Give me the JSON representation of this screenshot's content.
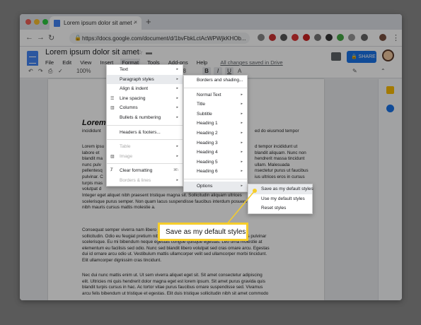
{
  "browser": {
    "tab_title": "Lorem ipsum dolor sit amet - ",
    "tab_close": "×",
    "new_tab": "+",
    "url": "https://docs.google.com/document/d/1bvFbkLctAcWPWjkKHOb..."
  },
  "doc": {
    "title": "Lorem ipsum dolor sit amet",
    "saved_status": "All changes saved in Drive",
    "share_label": "SHARE",
    "menus": [
      "File",
      "Edit",
      "View",
      "Insert",
      "Format",
      "Tools",
      "Add-ons",
      "Help"
    ]
  },
  "toolbar": {
    "zoom": "100%",
    "font_size": "18",
    "bold": "B",
    "italic": "I",
    "underline": "U",
    "text_color": "A"
  },
  "format_menu": {
    "items": [
      {
        "label": "Text",
        "arrow": "▸"
      },
      {
        "label": "Paragraph styles",
        "arrow": "▸"
      },
      {
        "label": "Align & indent",
        "arrow": "▸"
      },
      {
        "label": "Line spacing",
        "arrow": "▸"
      },
      {
        "label": "Columns",
        "arrow": "▸"
      },
      {
        "label": "Bullets & numbering",
        "arrow": "▸"
      },
      {
        "label": "Headers & footers..."
      },
      {
        "label": "Table",
        "arrow": "▸"
      },
      {
        "label": "Image",
        "arrow": "▸"
      },
      {
        "label": "Clear formatting",
        "shortcut": "⌘\\"
      },
      {
        "label": "Borders & lines",
        "arrow": "▸"
      }
    ]
  },
  "paragraph_menu": {
    "items": [
      {
        "label": "Borders and shading..."
      },
      {
        "label": "Normal Text",
        "arrow": "▸"
      },
      {
        "label": "Title",
        "arrow": "▸"
      },
      {
        "label": "Subtitle",
        "arrow": "▸"
      },
      {
        "label": "Heading 1",
        "arrow": "▸"
      },
      {
        "label": "Heading 2",
        "arrow": "▸"
      },
      {
        "label": "Heading 3",
        "arrow": "▸"
      },
      {
        "label": "Heading 4",
        "arrow": "▸"
      },
      {
        "label": "Heading 5",
        "arrow": "▸"
      },
      {
        "label": "Heading 6",
        "arrow": "▸"
      },
      {
        "label": "Options",
        "arrow": "▸"
      }
    ]
  },
  "options_menu": {
    "items": [
      {
        "label": "Save as my default styles"
      },
      {
        "label": "Use my default styles"
      },
      {
        "label": "Reset styles"
      }
    ]
  },
  "callout": "Save as my default styles",
  "body": {
    "heading": "Lorem",
    "subheading": "incididunt",
    "heading_right": "ed do eiusmod tempor",
    "para1_left": [
      "Lorem ipsu",
      "labore et",
      "blandit ma",
      "nunc pulv",
      "pellentesq",
      "pulvinar. C",
      "turpis mas",
      "volutpat d"
    ],
    "para1_right": [
      "d tempor incididunt ut",
      "blandit aliquam. Nunc non",
      "hendrerit massa tincidunt",
      "ullam. Malesuada",
      "nsectetur purus ut faucibus",
      "ius ultrices eros in cursus",
      "",
      ""
    ],
    "para1_full": [
      "Integer eget aliquet nibh praesent tristique magna sit. Sollicitudin aliquam ultrices",
      "scelerisque purus semper. Non quam lacus suspendisse faucibus interdum posuere lorem ipsum. In",
      "nibh mauris cursus mattis molestie a."
    ],
    "para2": [
      "Consequat semper viverra nam libero justo laoreet sit amet. Porttitor leo a diam",
      "sollicitudin. Odio eu feugiat pretium nibh ipsum consequat nisl. Quis viverra nibh cras pulvinar",
      "scelerisque. Eu mi bibendum neque egestas congue quisque egestas. Leo urna molestie at",
      "elementum eu facilisis sed odio. Nunc sed blandit libero volutpat sed cras ornare arcu. Egestas",
      "dui id ornare arcu odio ut. Vestibulum mattis ullamcorper velit sed ullamcorper morbi tincidunt.",
      "Elit ullamcorper dignissim cras tincidunt."
    ],
    "para3": [
      "Nec dui nunc mattis enim ut. Ut sem viverra aliquet eget sit. Sit amet consectetur adipiscing",
      "elit. Ultricies mi quis hendrerit dolor magna eget est lorem ipsum. Sit amet purus gravida quis",
      "blandit turpis cursus in hac. Ac tortor vitae purus faucibus ornare suspendisse sed. Vivamus",
      "arcu felis bibendum ut tristique et egestas. Elit duis tristique sollicitudin nibh sit amet commodo"
    ]
  },
  "colors": {
    "share": "#1a73e8",
    "callout_border": "#f6cd2a",
    "docs_blue": "#4285f4"
  }
}
